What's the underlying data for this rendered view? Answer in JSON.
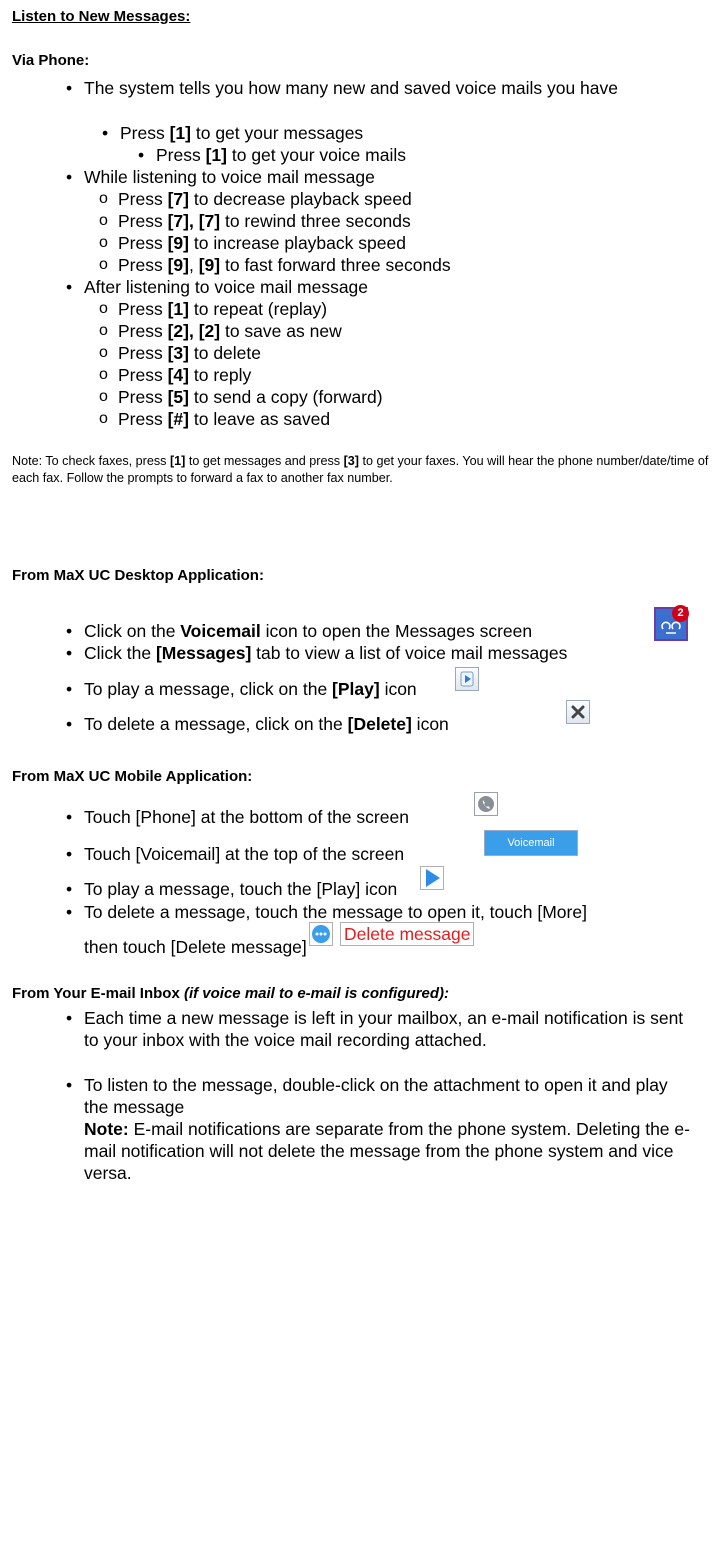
{
  "title": "Listen to New Messages:",
  "via_phone": {
    "heading": "Via Phone:",
    "item1": "The system tells you how many new and saved voice mails you have",
    "sub1": [
      "Press ",
      "[1]",
      " to get your messages"
    ],
    "subsub1": [
      "Press ",
      "[1]",
      " to get your voice mails"
    ],
    "item2": "While listening to voice mail message",
    "listen_press": [
      {
        "pre": "Press ",
        "k": "[7]",
        "post": " to decrease playback speed"
      },
      {
        "pre": "Press ",
        "k": "[7], [7]",
        "post": " to rewind three seconds"
      },
      {
        "pre": "Press ",
        "k": "[9]",
        "post": " to increase playback speed"
      },
      {
        "pre": "Press ",
        "k": "[9]",
        "mid": ", ",
        "k2": "[9]",
        "post": " to fast forward three seconds"
      }
    ],
    "item3": "After listening to voice mail message",
    "after_press": [
      {
        "pre": "Press ",
        "k": "[1]",
        "post": " to repeat (replay)"
      },
      {
        "pre": "Press ",
        "k": "[2], [2]",
        "post": " to save as new"
      },
      {
        "pre": "Press ",
        "k": "[3]",
        "post": " to delete"
      },
      {
        "pre": "Press ",
        "k": "[4]",
        "post": " to reply"
      },
      {
        "pre": "Press ",
        "k": "[5]",
        "post": " to send a copy (forward)"
      },
      {
        "pre": "Press ",
        "k": "[#]",
        "post": " to leave as saved"
      }
    ]
  },
  "note": {
    "a": "Note: To check faxes, press ",
    "k1": "[1]",
    "b": " to get messages and press ",
    "k2": "[3]",
    "c": " to get your faxes. You will hear the phone number/date/time of each fax. Follow the prompts to forward a fax to another fax number."
  },
  "desktop": {
    "heading": "From MaX UC Desktop Application:",
    "i1": [
      "Click on the ",
      "Voicemail",
      " icon to open the Messages screen"
    ],
    "badge_count": "2",
    "i2": [
      "Click the ",
      "[Messages]",
      " tab to view a list of voice mail messages"
    ],
    "i3": [
      "To play a message, click on the ",
      "[Play]",
      " icon"
    ],
    "i4": [
      "To delete a message, click on the ",
      "[Delete]",
      " icon"
    ]
  },
  "mobile": {
    "heading": "From MaX UC Mobile Application:",
    "i1": "Touch [Phone] at the bottom of the screen",
    "i2": "Touch [Voicemail] at the top of the screen",
    "voicemail_tab": "Voicemail",
    "i3": "To play a message, touch the [Play] icon",
    "i4a": "To delete a message, touch the message to open it, touch [More]",
    "i4b": "then touch [Delete message]",
    "delete_label": "Delete message"
  },
  "email": {
    "heading": "From Your E-mail Inbox ",
    "heading_italic": "(if voice mail to e-mail is configured):",
    "i1": "Each time a new message is left in your mailbox, an e-mail notification is sent to your inbox with the voice mail recording attached.",
    "i2": "To listen to the message, double-click on the attachment to open it and play the message",
    "note_label": "Note:",
    "note_text": " E-mail notifications are separate from the phone system. Deleting the e-mail notification will not delete the message from the phone system and vice versa."
  },
  "colors": {
    "accent_blue": "#3a9ee8",
    "badge_red": "#d0021b",
    "delete_red": "#e02020"
  }
}
